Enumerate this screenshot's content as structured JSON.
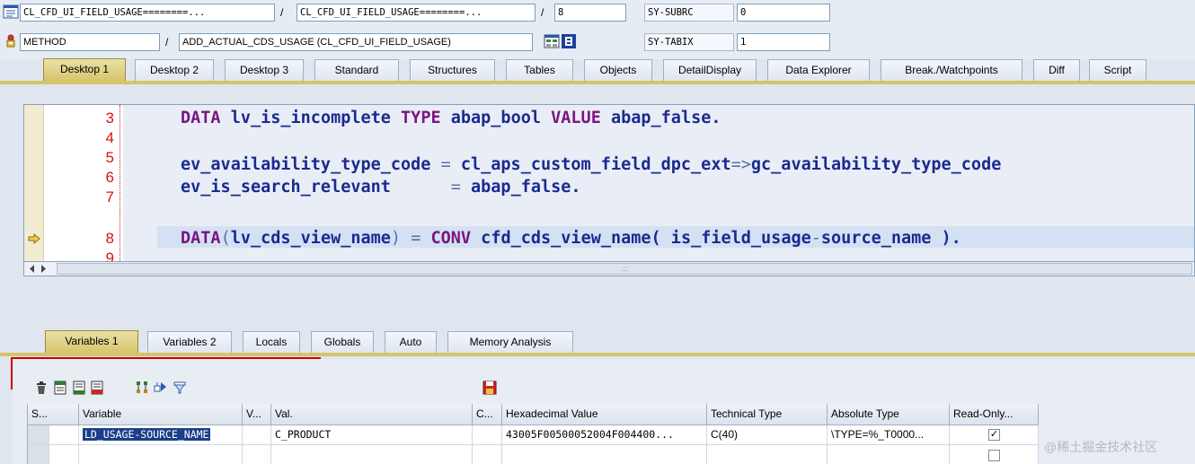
{
  "header": {
    "row1": {
      "field1": "CL_CFD_UI_FIELD_USAGE========...",
      "sep1": "/",
      "field2": "CL_CFD_UI_FIELD_USAGE========...",
      "sep2": "/",
      "field3": "8",
      "var_name": "SY-SUBRC",
      "var_value": "0"
    },
    "row2": {
      "field1": "METHOD",
      "sep1": "/",
      "field2": "ADD_ACTUAL_CDS_USAGE (CL_CFD_UI_FIELD_USAGE)",
      "var_name": "SY-TABIX",
      "var_value": "1"
    }
  },
  "main_tabs": [
    "Desktop 1",
    "Desktop 2",
    "Desktop 3",
    "Standard",
    "Structures",
    "Tables",
    "Objects",
    "DetailDisplay",
    "Data Explorer",
    "Break./Watchpoints",
    "Diff",
    "Script"
  ],
  "editor": {
    "line_numbers": [
      "3",
      "4",
      "5",
      "6",
      "7",
      "8",
      "9"
    ],
    "code": {
      "l3": {
        "kw1": "DATA",
        "t1": " lv_is_incomplete ",
        "kw2": "TYPE",
        "t2": " abap_bool ",
        "kw3": "VALUE",
        "t3": " abap_false."
      },
      "l5": {
        "t1": "ev_availability_type_code ",
        "op1": "=",
        "t2": " cl_aps_custom_field_dpc_ext",
        "op2": "=>",
        "t3": "gc_availability_type_code"
      },
      "l6": {
        "t1": "ev_is_search_relevant      ",
        "op1": "=",
        "t2": " abap_false."
      },
      "l8": {
        "kw1": "DATA",
        "op1": "(",
        "t1": "lv_cds_view_name",
        "op2": ")",
        "t2": " ",
        "op3": "=",
        "t3": " ",
        "kw2": "CONV",
        "t4": " cfd_cds_view_name( is_field_usage",
        "op4": "-",
        "t5": "source_name )."
      }
    },
    "scroll_grip": ":::"
  },
  "var_tabs": [
    "Variables 1",
    "Variables 2",
    "Locals",
    "Globals",
    "Auto",
    "Memory Analysis"
  ],
  "grid": {
    "columns": [
      "S...",
      "Variable",
      "V...",
      "Val.",
      "C...",
      "Hexadecimal Value",
      "Technical Type",
      "Absolute Type",
      "Read-Only..."
    ],
    "rows": [
      {
        "variable": "LD_USAGE-SOURCE_NAME",
        "value": "C_PRODUCT",
        "hex": "43005F00500052004F004400...",
        "technical_type": "C(40)",
        "absolute_type": "\\TYPE=%_T0000...",
        "read_only": "✓"
      }
    ]
  },
  "watermark": "@稀土掘金技术社区",
  "colors": {
    "active_tab": "#d6c46a",
    "keyword": "#7a1680",
    "identifier": "#1b2a8f",
    "line_number": "#dd1111"
  }
}
